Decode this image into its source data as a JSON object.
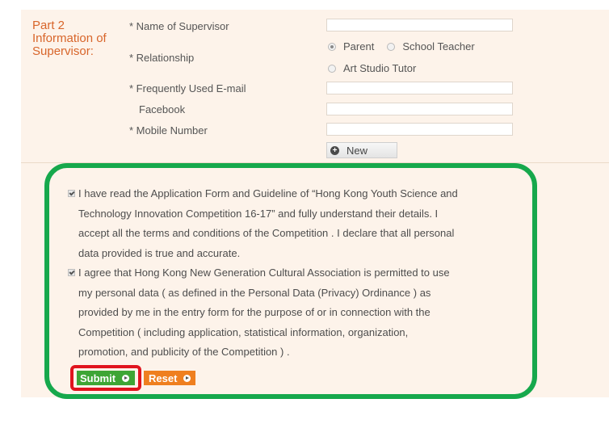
{
  "part": {
    "title_lines": [
      "Part 2",
      "Information of",
      "Supervisor:"
    ]
  },
  "form": {
    "name_label": "* Name of Supervisor",
    "relationship_label": "* Relationship",
    "relationship_options": [
      "Parent",
      "School Teacher",
      "Art Studio Tutor"
    ],
    "relationship_selected": "Parent",
    "email_label": "* Frequently Used E-mail",
    "facebook_label": "Facebook",
    "mobile_label": "* Mobile Number",
    "new_button": "New"
  },
  "agreements": [
    {
      "checked": true,
      "lines": [
        "I have read the Application Form and Guideline of “Hong Kong Youth Science and",
        "Technology Innovation Competition 16-17”  and fully understand their details. I",
        "accept all the terms and conditions of the Competition . I declare that all personal",
        "data provided is true and accurate."
      ]
    },
    {
      "checked": true,
      "lines": [
        "I agree that Hong Kong New Generation Cultural Association is permitted to use",
        "my personal data ( as defined in the Personal Data (Privacy) Ordinance ) as",
        "provided by me in the entry form for the purpose of or in connection with the",
        "Competition  ( including application, statistical information, organization,",
        "promotion, and publicity of the Competition ) ."
      ]
    }
  ],
  "actions": {
    "submit_label": "Submit",
    "reset_label": "Reset"
  },
  "highlight_colors": {
    "group_outline": "#16a84c",
    "submit_outline": "#e0141e"
  }
}
